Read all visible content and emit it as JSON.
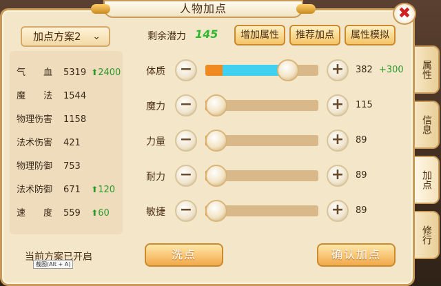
{
  "title": "人物加点",
  "close_icon": "✖",
  "plan_selector": {
    "label": "加点方案2",
    "icon": "chevron-down-icon"
  },
  "stats": [
    {
      "name": "气　　血",
      "value": "5319",
      "bonus": "2400"
    },
    {
      "name": "魔　　法",
      "value": "1544",
      "bonus": ""
    },
    {
      "name": "物理伤害",
      "value": "1158",
      "bonus": ""
    },
    {
      "name": "法术伤害",
      "value": "421",
      "bonus": ""
    },
    {
      "name": "物理防御",
      "value": "753",
      "bonus": ""
    },
    {
      "name": "法术防御",
      "value": "671",
      "bonus": "120"
    },
    {
      "name": "速　　度",
      "value": "559",
      "bonus": "60"
    }
  ],
  "status_text": "当前方案已开启",
  "tooltip": "截图(Alt + A)",
  "points": {
    "label": "剩余潜力",
    "value": "145"
  },
  "top_buttons": [
    "增加属性",
    "推荐加点",
    "属性模拟"
  ],
  "attributes": [
    {
      "name": "体质",
      "value": "382",
      "bonus": "+300",
      "base_level": 0.15,
      "added_level": 0.58
    },
    {
      "name": "魔力",
      "value": "115",
      "bonus": "",
      "base_level": 0.1,
      "added_level": 0
    },
    {
      "name": "力量",
      "value": "89",
      "bonus": "",
      "base_level": 0.06,
      "added_level": 0
    },
    {
      "name": "耐力",
      "value": "89",
      "bonus": "",
      "base_level": 0.06,
      "added_level": 0
    },
    {
      "name": "敏捷",
      "value": "89",
      "bonus": "",
      "base_level": 0.06,
      "added_level": 0
    }
  ],
  "bottom_buttons": {
    "reset": "洗点",
    "confirm": "确认加点"
  },
  "side_tabs": [
    "属性",
    "信息",
    "加点",
    "修行"
  ],
  "active_tab": "加点",
  "colors": {
    "accent": "#f4c467",
    "bonus_green": "#2a9a2a",
    "added_fill": "#40d0f0",
    "base_fill": "#f08a20"
  }
}
